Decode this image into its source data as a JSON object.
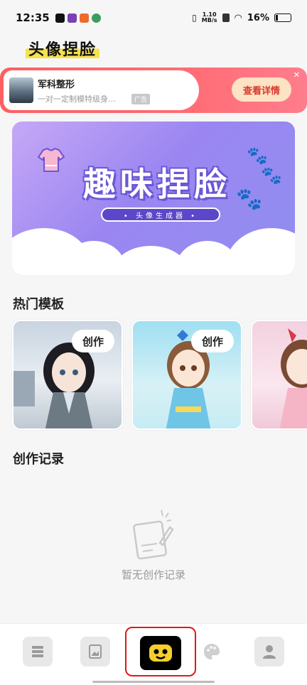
{
  "status_bar": {
    "time": "12:35",
    "net_speed": "1.10",
    "net_unit": "MB/s",
    "battery": "16%"
  },
  "app": {
    "title": "头像捏脸"
  },
  "ad": {
    "title": "军科整形",
    "description": "一对一定制模特级身…",
    "tag": "广告",
    "button": "查看详情"
  },
  "hero": {
    "title": "趣味捏脸",
    "subtitle": "• 头像生成器 •"
  },
  "sections": {
    "hot_templates": "热门模板",
    "creation_records": "创作记录"
  },
  "templates": [
    {
      "button": "创作"
    },
    {
      "button": "创作"
    },
    {
      "button": ""
    }
  ],
  "empty_state": {
    "text": "暂无创作记录"
  },
  "bottom_nav": {
    "items": [
      "library",
      "gallery",
      "face-editor",
      "palette",
      "profile"
    ],
    "active": "face-editor",
    "accent": "#e01919"
  }
}
